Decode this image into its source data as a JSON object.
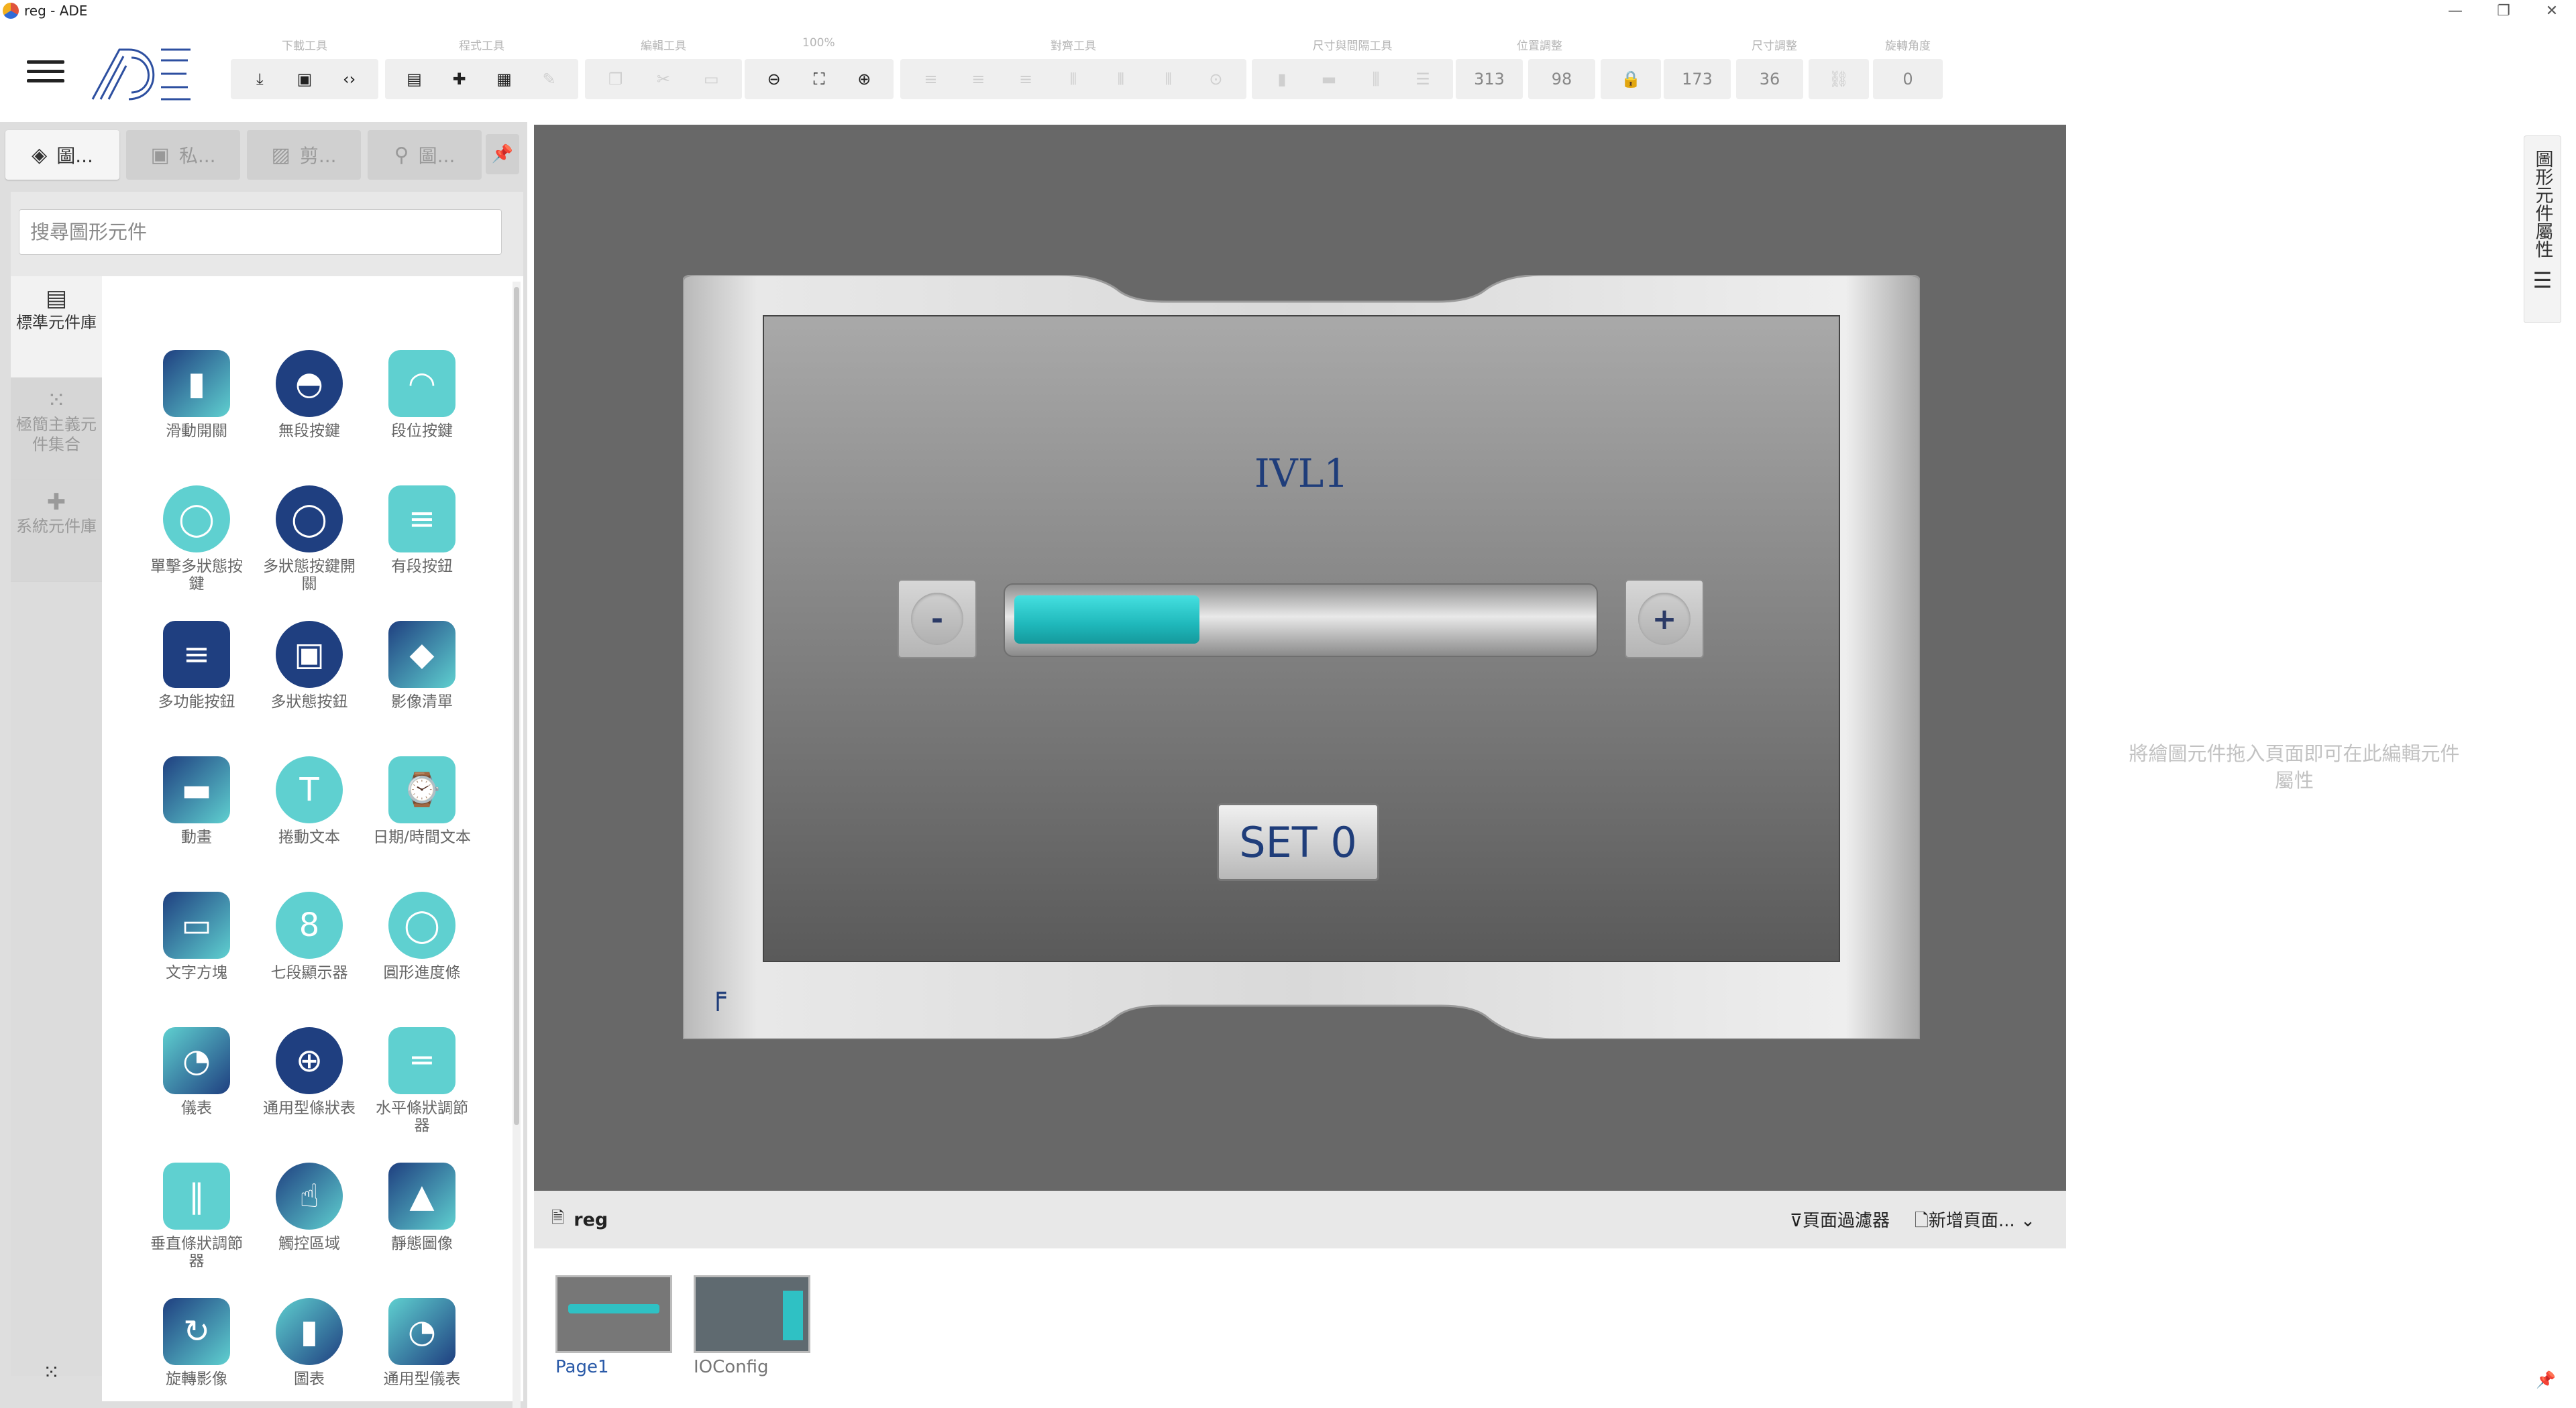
{
  "window": {
    "title": "reg - ADE",
    "min": "—",
    "restore": "❐",
    "close": "✕"
  },
  "toolbar": {
    "groups": {
      "download": "下載工具",
      "program": "程式工具",
      "edit": "編輯工具",
      "zoom": "100%",
      "align": "對齊工具",
      "size_spacing": "尺寸與間隔工具",
      "position": "位置調整",
      "size": "尺寸調整",
      "rotation": "旋轉角度"
    },
    "values": {
      "x": "313",
      "y": "98",
      "w": "173",
      "h": "36",
      "angle": "0"
    }
  },
  "left_panel": {
    "tabs": [
      {
        "icon": "layers-icon",
        "label": "圖..."
      },
      {
        "icon": "briefcase-icon",
        "label": "私..."
      },
      {
        "icon": "image-icon",
        "label": "剪..."
      },
      {
        "icon": "map-pin-icon",
        "label": "圖..."
      }
    ],
    "search_placeholder": "搜尋圖形元件",
    "libraries": [
      {
        "label": "標準元件庫",
        "icon": "widget-icon"
      },
      {
        "label": "極簡主義元件集合",
        "icon": "grid-icon"
      },
      {
        "label": "系統元件庫",
        "icon": "puzzle-icon"
      }
    ],
    "components": [
      "滑動開關",
      "無段按鍵",
      "段位按鍵",
      "單擊多狀態按鍵",
      "多狀態按鍵開關",
      "有段按鈕",
      "多功能按鈕",
      "多狀態按鈕",
      "影像清單",
      "動畫",
      "捲動文本",
      "日期/時間文本",
      "文字方塊",
      "七段顯示器",
      "圓形進度條",
      "儀表",
      "通用型條狀表",
      "水平條狀調節器",
      "垂直條狀調節器",
      "觸控區域",
      "靜態圖像",
      "旋轉影像",
      "圖表",
      "通用型儀表"
    ]
  },
  "canvas": {
    "title": "IVL1",
    "minus": "-",
    "plus": "+",
    "slider_level": 0.32,
    "button": "SET 0",
    "accent": "#1fb8bb"
  },
  "right_panel": {
    "hint": "將繪圖元件拖入頁面即可在此編輯元件屬性",
    "tab": "圖形元件屬性"
  },
  "pages": {
    "project": "reg",
    "filter": "頁面過濾器",
    "new_page": "新增頁面...",
    "items": [
      "Page1",
      "IOConfig"
    ]
  }
}
